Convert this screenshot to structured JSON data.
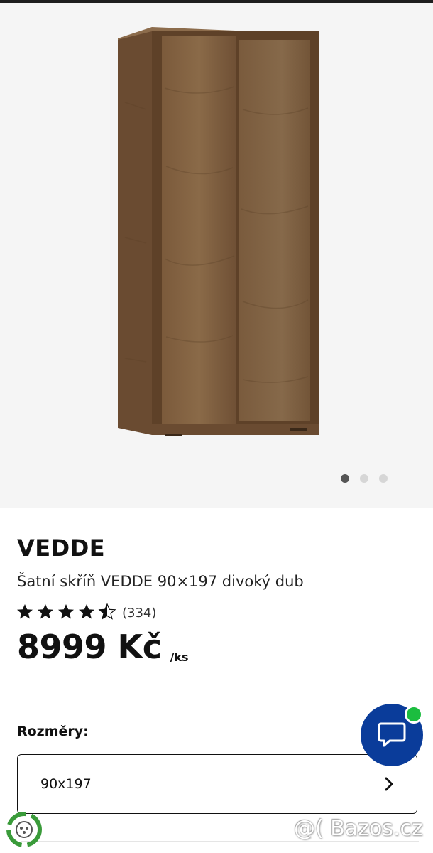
{
  "product": {
    "brand": "VEDDE",
    "description": "Šatní skříň VEDDE 90×197 divoký dub",
    "rating": {
      "stars": 4.5,
      "max_stars": 5,
      "count": "(334)"
    },
    "price": {
      "amount": "8999 Kč",
      "unit": "/ks"
    }
  },
  "gallery": {
    "image_count": 3,
    "active_index": 0
  },
  "dimensions": {
    "label": "Rozměry:",
    "selected": "90x197"
  },
  "watermark": "@( Bazos.cz",
  "colors": {
    "primary_blue": "#0a3c9a",
    "online_green": "#1bbd3f",
    "wood": "#7a5a3c"
  },
  "icons": {
    "chat": "chat-bubble-icon",
    "chevron": "chevron-right-icon",
    "recycle": "recycle-icon"
  }
}
